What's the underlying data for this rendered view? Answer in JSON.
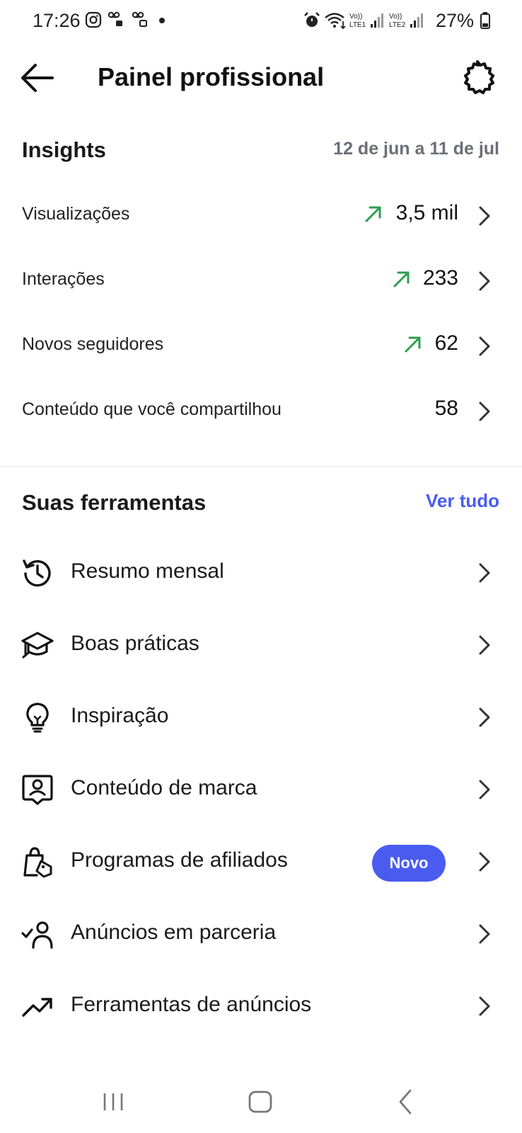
{
  "status_bar": {
    "time": "17:26",
    "battery": "27%",
    "icons": [
      "instagram-icon",
      "voicemail-icon",
      "voicemail-icon",
      "dot-icon",
      "alarm-icon",
      "wifi-icon",
      "lte1-signal-icon",
      "lte2-signal-icon",
      "battery-icon"
    ]
  },
  "header": {
    "title": "Painel profissional",
    "back_icon": "arrow-left-icon",
    "settings_icon": "gear-icon"
  },
  "insights": {
    "title": "Insights",
    "date_range": "12 de jun a 11 de jul",
    "trend_color": "#2e9e4f",
    "metrics": [
      {
        "label": "Visualizações",
        "value": "3,5 mil",
        "trend": "up"
      },
      {
        "label": "Interações",
        "value": "233",
        "trend": "up"
      },
      {
        "label": "Novos seguidores",
        "value": "62",
        "trend": "up"
      },
      {
        "label": "Conteúdo que você compartilhou",
        "value": "58",
        "trend": "none"
      }
    ]
  },
  "tools": {
    "title": "Suas ferramentas",
    "see_all": "Ver tudo",
    "accent_color": "#4a5cf0",
    "items": [
      {
        "label": "Resumo mensal",
        "icon": "history-icon"
      },
      {
        "label": "Boas práticas",
        "icon": "graduation-cap-icon"
      },
      {
        "label": "Inspiração",
        "icon": "lightbulb-icon"
      },
      {
        "label": "Conteúdo de marca",
        "icon": "branded-content-icon"
      },
      {
        "label": "Programas de afiliados",
        "icon": "shopping-bag-tag-icon",
        "badge": "Novo"
      },
      {
        "label": "Anúncios em parceria",
        "icon": "user-check-icon"
      },
      {
        "label": "Ferramentas de anúncios",
        "icon": "trending-up-icon"
      }
    ]
  },
  "nav_bar": {
    "items": [
      "recents-icon",
      "home-icon",
      "back-icon"
    ]
  }
}
